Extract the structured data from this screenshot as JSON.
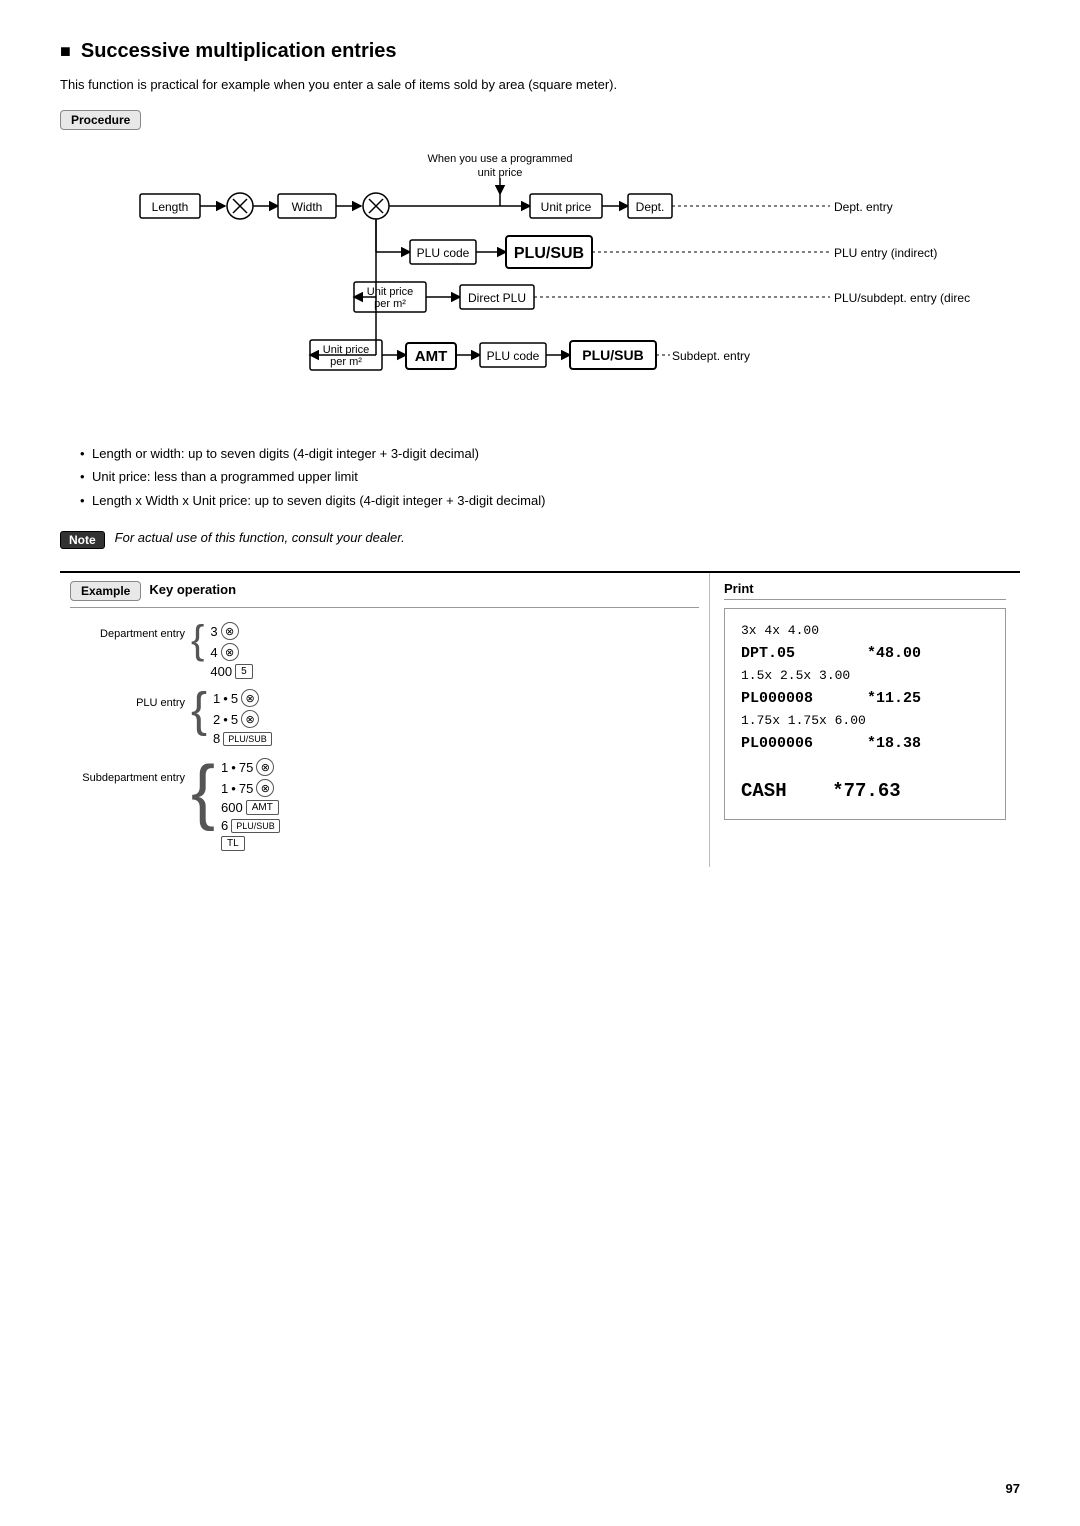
{
  "title": "Successive multiplication entries",
  "intro": "This function is practical for example when you enter a sale of items sold by area (square meter).",
  "procedure_badge": "Procedure",
  "diagram": {
    "when_label": "When you use a programmed",
    "unit_price_label": "unit price",
    "length_label": "Length",
    "width_label": "Width",
    "unit_price_box": "Unit price",
    "dept_box": "Dept.",
    "dept_entry": "Dept. entry",
    "plu_code_label": "PLU code",
    "plu_sub_large": "PLU/SUB",
    "plu_entry_indirect": "PLU entry (indirect)",
    "unit_price_per_m2a": "Unit price",
    "per_m2a": "per m²",
    "direct_plu_label": "Direct PLU",
    "plu_subdept_direct": "PLU/subdept. entry (direct)",
    "unit_price_per_m2b": "Unit price",
    "per_m2b": "per m²",
    "amt_label": "AMT",
    "plu_code2": "PLU code",
    "plu_sub2": "PLU/SUB",
    "subdept_entry": "Subdept. entry"
  },
  "bullets": [
    "Length or width: up to seven digits (4-digit integer + 3-digit decimal)",
    "Unit price: less than a programmed upper limit",
    "Length x Width x Unit price: up to seven digits (4-digit integer + 3-digit decimal)"
  ],
  "note_badge": "Note",
  "note_text": "For actual use of this function, consult your dealer.",
  "example_badge": "Example",
  "key_operation_label": "Key operation",
  "print_label": "Print",
  "entries": {
    "dept_label": "Department entry",
    "plu_label": "PLU entry",
    "subdept_label": "Subdepartment entry"
  },
  "print_lines": [
    "3x 4x 4.00",
    "DPT.05        *48.00",
    "1.5x 2.5x 3.00",
    "PL000008      *11.25",
    "1.75x 1.75x 6.00",
    "PL000006      *18.38",
    "",
    "CASH    *77.63"
  ],
  "page_number": "97"
}
